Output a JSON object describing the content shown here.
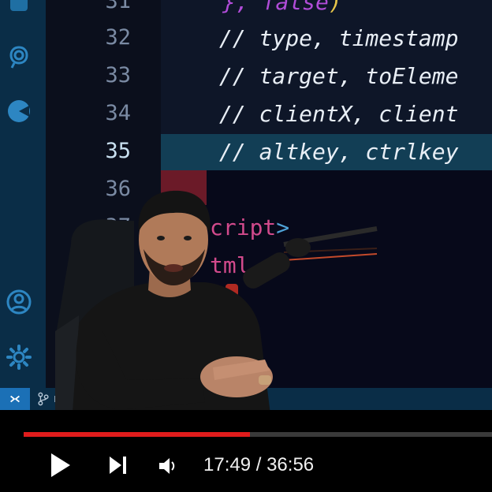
{
  "editor": {
    "line_numbers": [
      "31",
      "32",
      "33",
      "34",
      "35",
      "36",
      "37"
    ],
    "active_line": "35",
    "code": {
      "line31_a": "}, ",
      "line31_b": "false",
      "line31_c": ")",
      "line32": "// type, timestamp",
      "line33": "// target, toEleme",
      "line34": "// clientX, client",
      "line35": "// altkey, ctrlkey",
      "tag1_text": "cript",
      "tag1_close": ">",
      "tag2_text": "tml"
    }
  },
  "activity_bar": {
    "icons": [
      "extensions-icon",
      "remote-explorer-icon",
      "live-share-icon",
      "account-icon",
      "settings-gear-icon"
    ]
  },
  "status_bar": {
    "branch": "ma"
  },
  "player": {
    "current_time": "17:49",
    "separator": " / ",
    "duration": "36:56",
    "progress": 0.484,
    "colors": {
      "progress": "#e01c1c",
      "track": "#3a3a3a"
    }
  }
}
